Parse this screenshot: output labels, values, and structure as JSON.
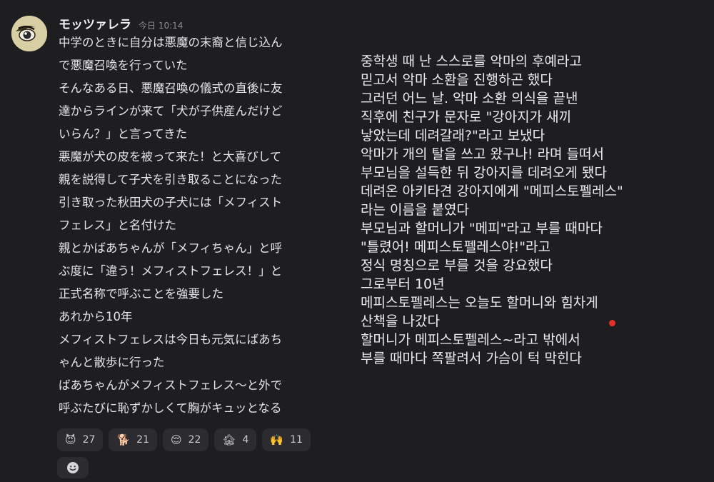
{
  "post": {
    "username": "モッツァレラ",
    "timestamp": "今日 10:14",
    "message_lines": [
      "中学のときに自分は悪魔の末裔と信じ込ん",
      "で悪魔召喚を行っていた",
      "そんなある日、悪魔召喚の儀式の直後に友",
      "達からラインが来て「犬が子供産んだけど",
      "いらん？」と言ってきた",
      "悪魔が犬の皮を被って来た！と大喜びして",
      "親を説得して子犬を引き取ることになった",
      "引き取った秋田犬の子犬には「メフィスト",
      "フェレス」と名付けた",
      "親とかばあちゃんが「メフィちゃん」と呼",
      "ぶ度に「違う！メフィストフェレス！」と",
      "正式名称で呼ぶことを強要した",
      "あれから10年",
      "メフィストフェレスは今日も元気にばあち",
      "ゃんと散歩に行った",
      "ばあちゃんがメフィストフェレス〜と外で",
      "呼ぶたびに恥ずかしくて胸がキュッとなる"
    ]
  },
  "reactions": [
    {
      "emoji": "😈",
      "icon": "devil-icon",
      "count": "27"
    },
    {
      "emoji": "🐕",
      "icon": "dog-icon",
      "count": "21"
    },
    {
      "emoji": "😌",
      "icon": "relieved-face-icon",
      "count": "22"
    },
    {
      "emoji": "🏚",
      "icon": "house-icon",
      "count": "4"
    },
    {
      "emoji": "🙌",
      "icon": "raised-hands-icon",
      "count": "11"
    }
  ],
  "translation_lines": [
    "중학생 때 난 스스로를 악마의 후예라고",
    "믿고서 악마 소환을 진행하곤 했다",
    "그러던 어느 날. 악마 소환 의식을 끝낸",
    "직후에 친구가 문자로 \"강아지가 새끼",
    "낳았는데 데려갈래?\"라고 보냈다",
    "악마가 개의 탈을 쓰고 왔구나! 라며 들떠서",
    "부모님을 설득한 뒤 강아지를 데려오게 됐다",
    "데려온 아키타견 강아지에게 \"메피스토펠레스\"",
    "라는 이름을 붙였다",
    "부모님과 할머니가 \"메피\"라고 부를 때마다",
    "\"틀렸어! 메피스토펠레스야!\"라고",
    "정식 명칭으로 부를 것을 강요했다",
    "그로부터 10년",
    "메피스토펠레스는 오늘도 할머니와 힘차게",
    "산책을 나갔다",
    "할머니가 메피스토펠레스~라고 밖에서",
    "부를 때마다 쪽팔려서 가슴이 턱 막힌다"
  ],
  "colors": {
    "background": "#1e1e20",
    "reaction_bg": "#2c2c30",
    "text": "#e6e6e8",
    "muted": "#8d8d94",
    "dot": "#e8302a"
  }
}
